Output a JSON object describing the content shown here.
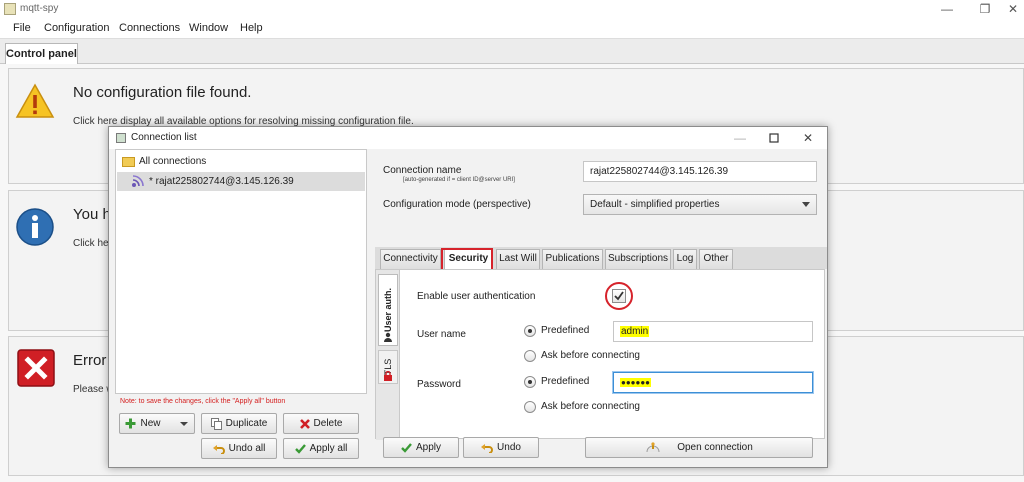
{
  "window": {
    "title": "mqtt-spy",
    "min_glyph": "—",
    "max_glyph": "❐",
    "close_glyph": "✕"
  },
  "menu": [
    "File",
    "Configuration",
    "Connections",
    "Window",
    "Help"
  ],
  "tabs": {
    "control_panel": "Control panel"
  },
  "panels": {
    "config": {
      "title": "No configuration file found.",
      "desc": "Click here display all available options for resolving missing configuration file."
    },
    "info": {
      "title": "You h",
      "desc": "Click he"
    },
    "error": {
      "title": "Error",
      "desc": "Please w"
    }
  },
  "dialog": {
    "title": "Connection list",
    "tree": {
      "root": "All connections",
      "connection": "* rajat225802744@3.145.126.39"
    },
    "note": "Note: to save the changes, click the \"Apply all\" button",
    "left_buttons": {
      "new": "New",
      "duplicate": "Duplicate",
      "delete": "Delete",
      "undo_all": "Undo all",
      "apply_all": "Apply all"
    },
    "form": {
      "connection_name_label": "Connection name",
      "connection_name_hint": "[auto-generated if = client ID@server URI]",
      "connection_name_value": "rajat225802744@3.145.126.39",
      "config_mode_label": "Configuration mode (perspective)",
      "config_mode_value": "Default - simplified properties"
    },
    "tabs": [
      "Connectivity",
      "Security",
      "Last Will",
      "Publications",
      "Subscriptions",
      "Log",
      "Other"
    ],
    "active_tab": "Security",
    "security": {
      "vertical_tabs": [
        "User auth.",
        "TLS"
      ],
      "enable_auth_label": "Enable user authentication",
      "enable_auth_checked": true,
      "username_label": "User name",
      "username_predefined_label": "Predefined",
      "username_ask_label": "Ask before connecting",
      "username_value": "admin",
      "password_label": "Password",
      "password_predefined_label": "Predefined",
      "password_ask_label": "Ask before connecting",
      "password_value": "●●●●●●"
    },
    "bottom_buttons": {
      "apply": "Apply",
      "undo": "Undo",
      "open_connection": "Open connection"
    }
  },
  "colors": {
    "highlight_red": "#d6232b",
    "field_focus": "#3c8fd6",
    "marker_yellow": "#ffff00",
    "warning_yellow": "#f6c324",
    "info_blue": "#2f6fb3",
    "error_red": "#d01f25"
  }
}
